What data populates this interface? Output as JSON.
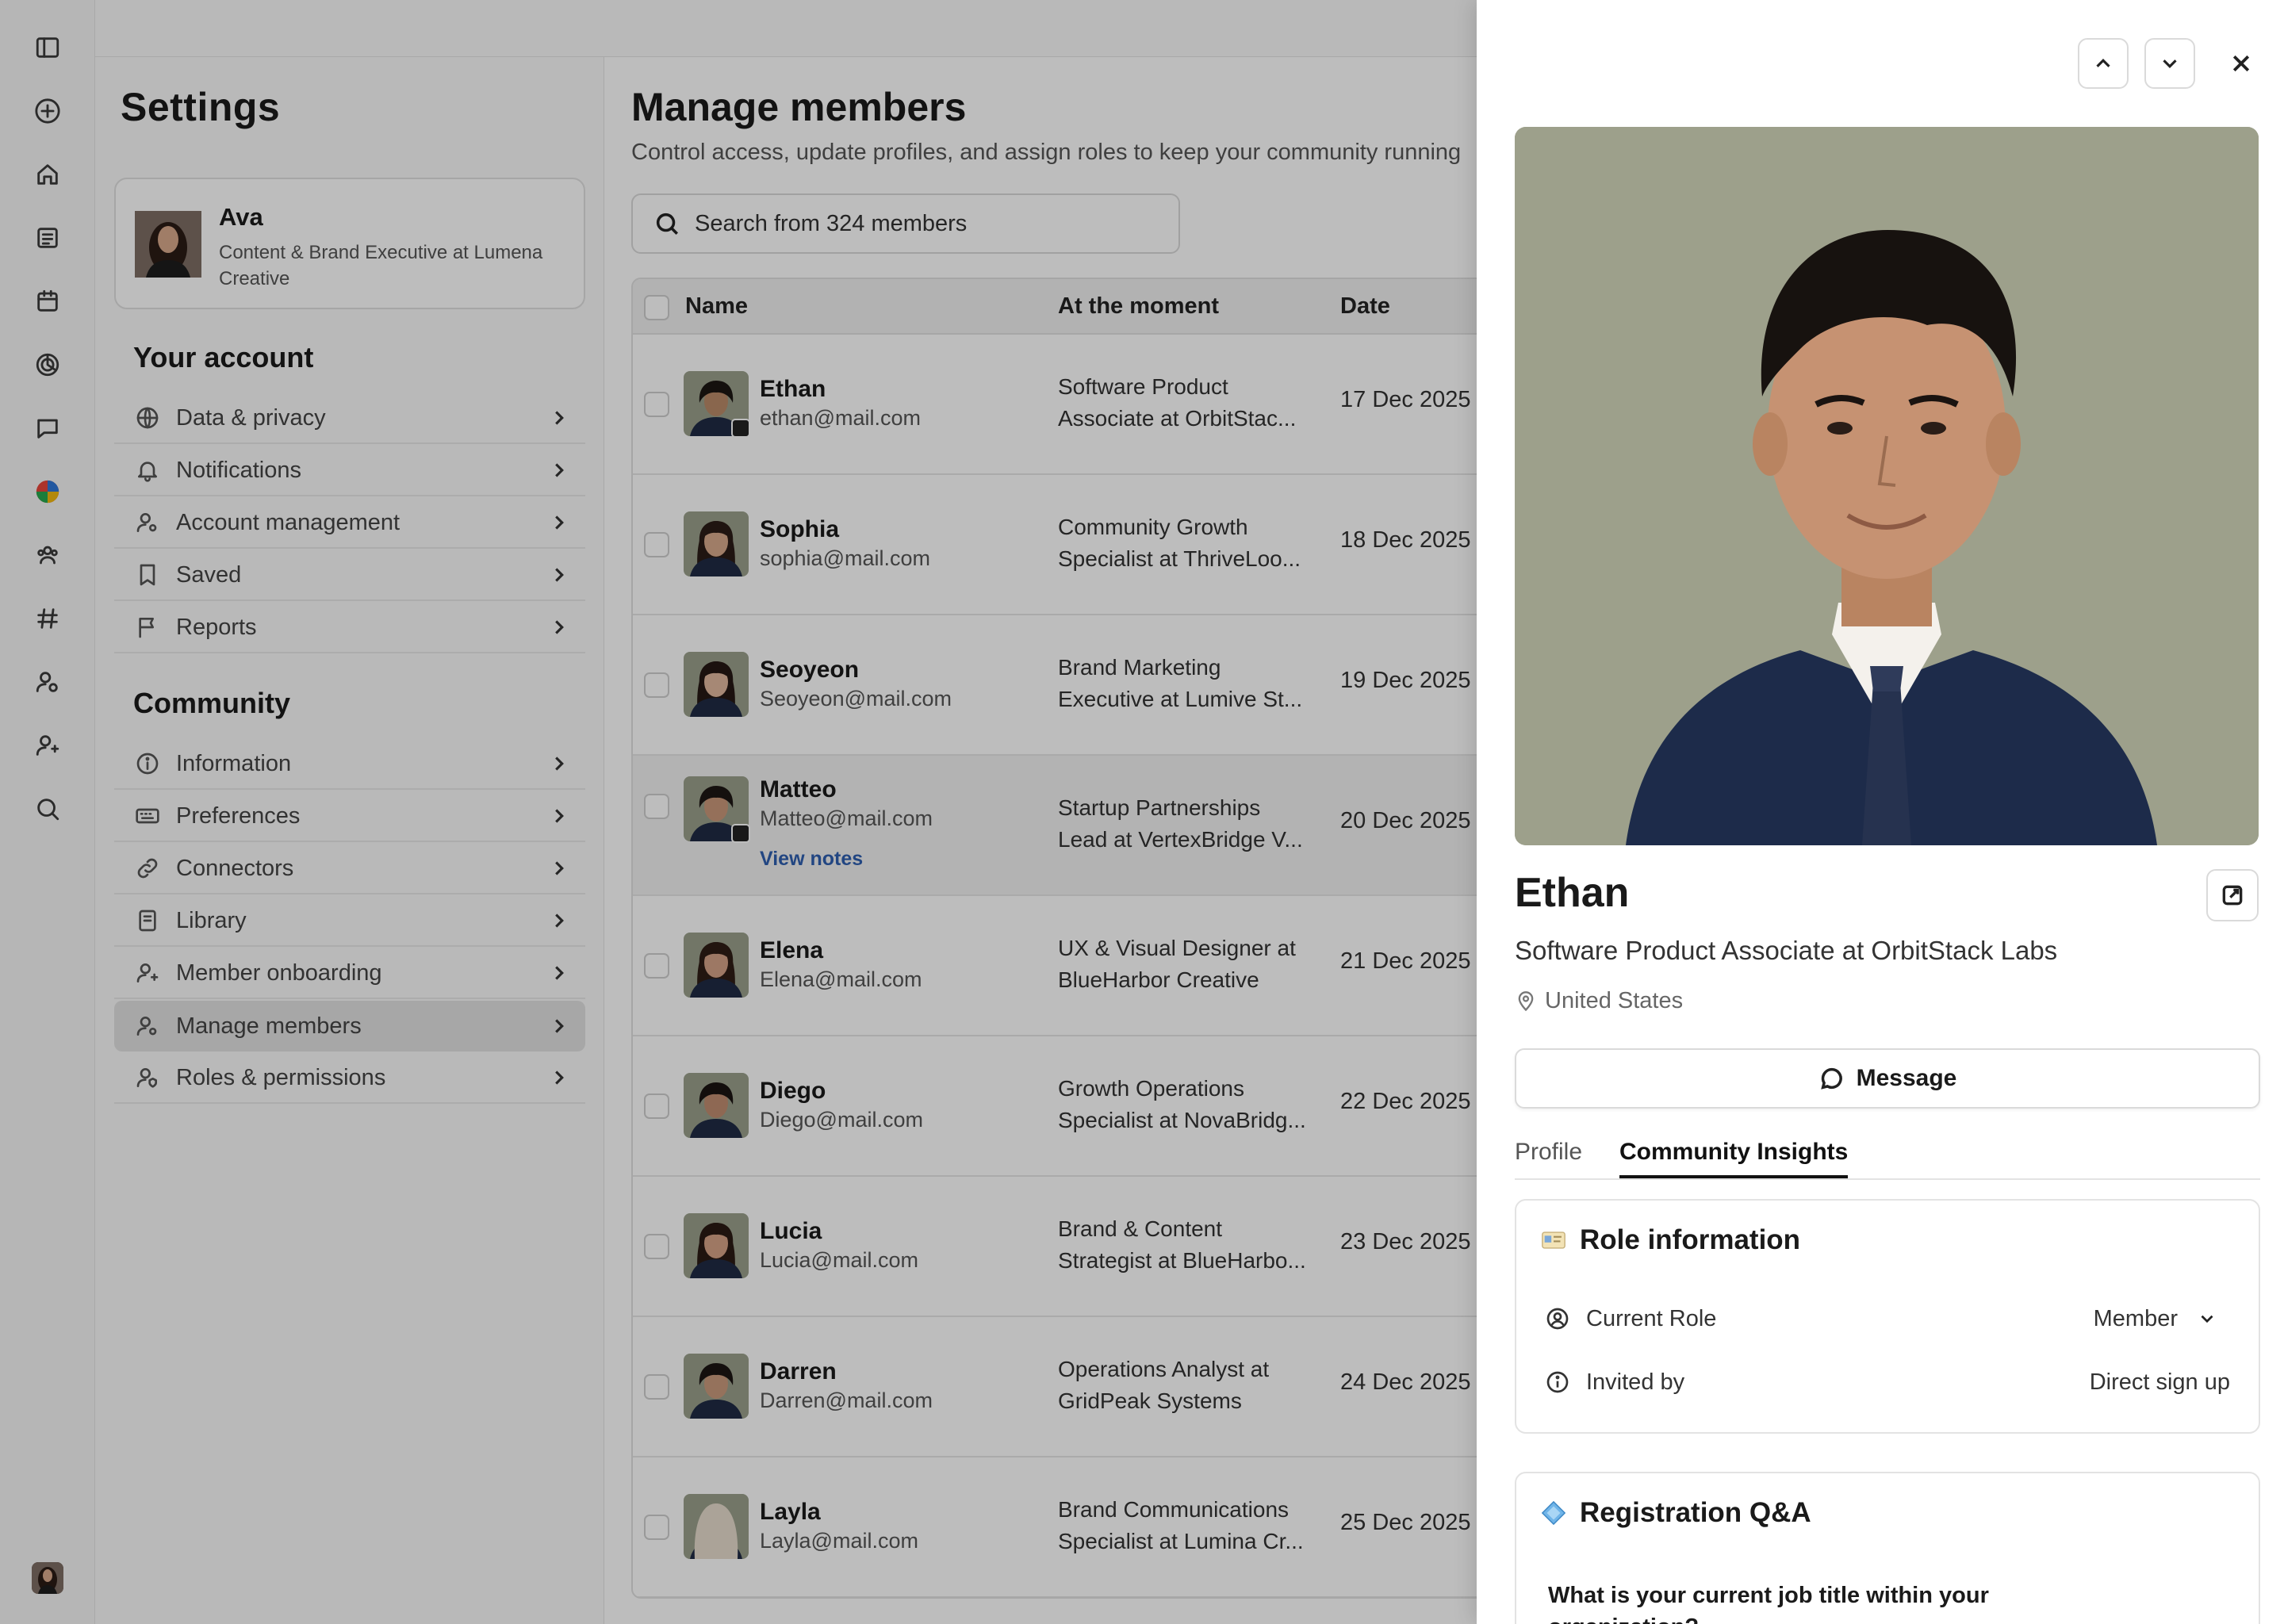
{
  "settings": {
    "title": "Settings",
    "profile": {
      "name": "Ava",
      "subtitle": "Content & Brand Executive at Lumena Creative"
    },
    "your_account": {
      "title": "Your account",
      "items": [
        {
          "label": "Data & privacy",
          "icon": "globe-icon"
        },
        {
          "label": "Notifications",
          "icon": "bell-icon"
        },
        {
          "label": "Account management",
          "icon": "user-cog-icon"
        },
        {
          "label": "Saved",
          "icon": "bookmark-icon"
        },
        {
          "label": "Reports",
          "icon": "flag-icon"
        }
      ]
    },
    "community": {
      "title": "Community",
      "items": [
        {
          "label": "Information",
          "icon": "info-icon"
        },
        {
          "label": "Preferences",
          "icon": "keyboard-icon"
        },
        {
          "label": "Connectors",
          "icon": "link-icon"
        },
        {
          "label": "Library",
          "icon": "book-icon"
        },
        {
          "label": "Member onboarding",
          "icon": "user-plus-icon"
        },
        {
          "label": "Manage members",
          "icon": "users-icon",
          "active": true
        },
        {
          "label": "Roles & permissions",
          "icon": "user-shield-icon"
        }
      ]
    }
  },
  "main": {
    "title": "Manage members",
    "description": "Control access, update profiles, and assign roles to keep your community running",
    "search_placeholder": "Search from 324 members",
    "columns": [
      "Name",
      "At the moment",
      "Date"
    ],
    "rows": [
      {
        "name": "Ethan",
        "email": "ethan@mail.com",
        "at_moment": "Software Product Associate at OrbitStac...",
        "date": "17 Dec 2025",
        "badge": true,
        "skin": "#b98a68",
        "hair": "#1c1612"
      },
      {
        "name": "Sophia",
        "email": "sophia@mail.com",
        "at_moment": "Community Growth Specialist at ThriveLoo...",
        "date": "18 Dec 2025",
        "skin": "#d7a98b",
        "hair": "#2b1c16"
      },
      {
        "name": "Seoyeon",
        "email": "Seoyeon@mail.com",
        "at_moment": "Brand Marketing Executive at Lumive St...",
        "date": "19 Dec 2025",
        "skin": "#e0b89e",
        "hair": "#251813"
      },
      {
        "name": "Matteo",
        "email": "Matteo@mail.com",
        "at_moment": "Startup Partnerships Lead at VertexBridge V...",
        "date": "20 Dec 2025",
        "badge": true,
        "notes": "View notes",
        "highlight": true,
        "skin": "#c9977a",
        "hair": "#1d1613"
      },
      {
        "name": "Elena",
        "email": "Elena@mail.com",
        "at_moment": "UX & Visual Designer at BlueHarbor Creative",
        "date": "21 Dec 2025",
        "skin": "#d4a287",
        "hair": "#2e1d15"
      },
      {
        "name": "Diego",
        "email": "Diego@mail.com",
        "at_moment": "Growth Operations Specialist at NovaBridg...",
        "date": "22 Dec 2025",
        "skin": "#c08d70",
        "hair": "#1a1411"
      },
      {
        "name": "Lucia",
        "email": "Lucia@mail.com",
        "at_moment": "Brand & Content Strategist at BlueHarbo...",
        "date": "23 Dec 2025",
        "skin": "#d6a286",
        "hair": "#2a1a13"
      },
      {
        "name": "Darren",
        "email": "Darren@mail.com",
        "at_moment": "Operations Analyst at GridPeak Systems",
        "date": "24 Dec 2025",
        "skin": "#c99a7c",
        "hair": "#1b1512"
      },
      {
        "name": "Layla",
        "email": "Layla@mail.com",
        "at_moment": "Brand Communications Specialist at Lumina Cr...",
        "date": "25 Dec 2025",
        "skin": "#d8ab8f",
        "hair": "#e7dccd"
      }
    ]
  },
  "drawer": {
    "name": "Ethan",
    "title": "Software Product Associate at OrbitStack Labs",
    "location": "United States",
    "message_label": "Message",
    "tabs": [
      {
        "label": "Profile",
        "active": false
      },
      {
        "label": "Community Insights",
        "active": true
      }
    ],
    "role_card": {
      "title": "Role information",
      "current_role_label": "Current Role",
      "current_role_value": "Member",
      "invited_by_label": "Invited by",
      "invited_by_value": "Direct sign up"
    },
    "qa_card": {
      "title": "Registration Q&A",
      "question": "What is your current job title within your organization?"
    }
  },
  "colors": {
    "hero_bg": "#9da08b",
    "suit": "#1d2b4a",
    "scrim": "rgba(0,0,0,0.26)",
    "link": "#2f5fb0"
  }
}
